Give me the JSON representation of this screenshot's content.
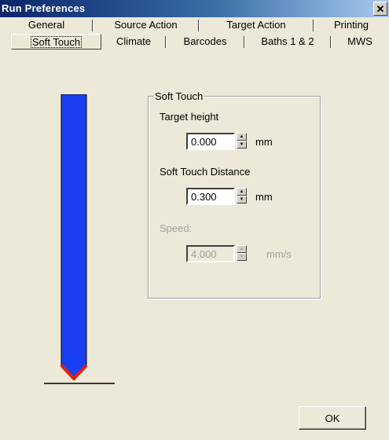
{
  "window": {
    "title": "Run Preferences",
    "close_glyph": "✕"
  },
  "tabs": {
    "top_row": [
      "General",
      "Source Action",
      "Target Action",
      "Printing"
    ],
    "bottom_row": [
      "Soft Touch",
      "Climate",
      "Barcodes",
      "Baths 1 & 2",
      "MWS"
    ],
    "active": "Soft Touch"
  },
  "soft_touch": {
    "group_title": "Soft Touch",
    "target_height": {
      "label": "Target height",
      "value": "0.000",
      "unit": "mm"
    },
    "soft_touch_distance": {
      "label": "Soft Touch Distance",
      "value": "0.300",
      "unit": "mm"
    },
    "speed": {
      "label": "Speed:",
      "value": "4.000",
      "unit": "mm/s",
      "enabled": false
    }
  },
  "buttons": {
    "ok_label": "OK"
  },
  "colors": {
    "probe_body": "#1a3ff0",
    "probe_tip": "#e82000",
    "title_bar_start": "#0a246a",
    "dialog_background": "#ece9d8"
  }
}
